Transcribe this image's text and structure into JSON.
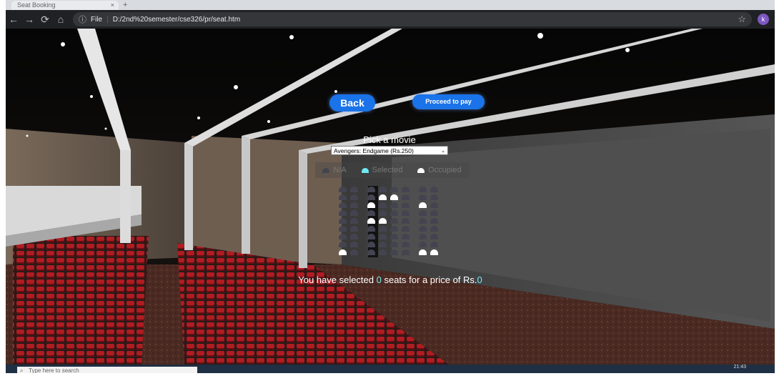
{
  "browser": {
    "tab_title": "Seat Booking",
    "tab_close": "×",
    "new_tab": "+",
    "nav_back": "←",
    "nav_forward": "→",
    "nav_reload": "⟳",
    "nav_home": "⌂",
    "info_icon": "ⓘ",
    "file_label": "File",
    "separator": "|",
    "url": "D:/2nd%20semester/cse326/pr/seat.htm",
    "bookmark_icon": "☆",
    "profile_initial": "k"
  },
  "page": {
    "back_label": "Back",
    "proceed_label": "Proceed to pay",
    "pick_label": "Pick a movie",
    "selected_movie": "Avengers: Endgame (Rs.250)",
    "select_arrow": "⌄",
    "legend": {
      "na": "N/A",
      "selected": "Selected",
      "occupied": "Occupied"
    },
    "summary": {
      "prefix": "You have selected ",
      "count": "0",
      "middle": " seats for a price of Rs.",
      "price": "0"
    },
    "seat_rows": [
      [
        "na",
        "na",
        "gap",
        "na",
        "na",
        "na",
        "na",
        "gap",
        "na",
        "na"
      ],
      [
        "na",
        "na",
        "gap",
        "na",
        "occ",
        "occ",
        "na",
        "gap",
        "na",
        "na"
      ],
      [
        "na",
        "na",
        "gap",
        "occ",
        "na",
        "na",
        "na",
        "gap",
        "occ",
        "na"
      ],
      [
        "na",
        "na",
        "gap",
        "na",
        "na",
        "na",
        "na",
        "gap",
        "na",
        "na"
      ],
      [
        "na",
        "na",
        "gap",
        "occ",
        "occ",
        "na",
        "na",
        "gap",
        "na",
        "na"
      ],
      [
        "na",
        "na",
        "gap",
        "na",
        "na",
        "na",
        "na",
        "gap",
        "na",
        "na"
      ],
      [
        "na",
        "na",
        "gap",
        "na",
        "na",
        "na",
        "na",
        "gap",
        "na",
        "na"
      ],
      [
        "na",
        "na",
        "gap",
        "na",
        "na",
        "na",
        "na",
        "gap",
        "na",
        "na"
      ],
      [
        "occ",
        "na",
        "gap",
        "na",
        "na",
        "na",
        "na",
        "gap",
        "occ",
        "occ"
      ]
    ],
    "colors": {
      "accent": "#1a73e8",
      "selected": "#6feaf6",
      "na": "#444451",
      "occupied": "#ffffff"
    }
  },
  "taskbar": {
    "search_icon": "⌕",
    "search_placeholder": "Type here to search",
    "time": "21:43"
  }
}
